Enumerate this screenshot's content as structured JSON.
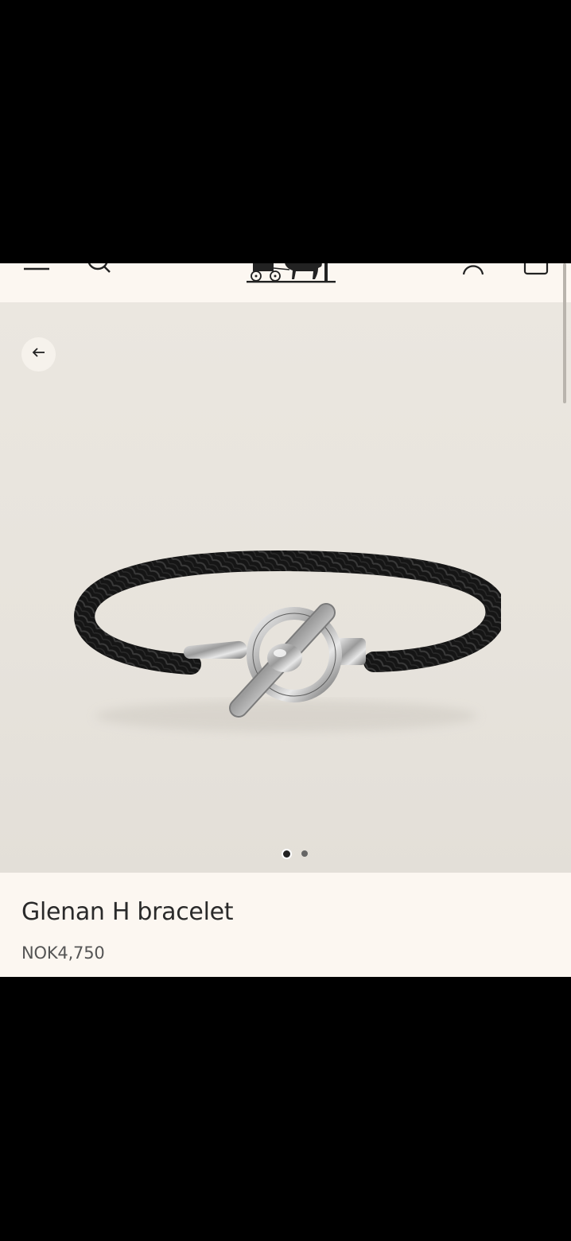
{
  "header": {
    "menu_icon": "menu-icon",
    "search_icon": "search-icon",
    "logo_icon": "carriage-logo",
    "account_icon": "account-icon",
    "bag_icon": "shopping-bag-icon"
  },
  "gallery": {
    "back_icon": "arrow-left-icon",
    "image_subject": "black braided leather bracelet with silver toggle clasp",
    "slide_count": 2,
    "active_slide": 1
  },
  "product": {
    "title": "Glenan H bracelet",
    "price": "NOK4,750"
  },
  "colors": {
    "background": "#fcf7f1",
    "gallery": "#e8e4dd",
    "text": "#2a2a2a"
  }
}
